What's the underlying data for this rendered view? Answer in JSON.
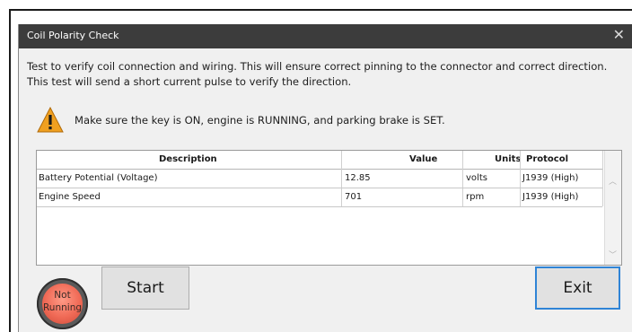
{
  "window": {
    "title": "Coil Polarity Check",
    "close_symbol": "✕"
  },
  "description": {
    "line1": "Test to verify coil connection and wiring. This will ensure correct pinning to the connector and correct direction.",
    "line2": "This test will send a short current pulse to verify the direction."
  },
  "warning": {
    "icon": "warning-triangle-icon",
    "text": "Make sure the key is ON, engine is RUNNING, and parking brake is SET."
  },
  "table": {
    "columns": [
      "Description",
      "Value",
      "Units",
      "Protocol"
    ],
    "rows": [
      [
        "Battery Potential (Voltage)",
        "12.85",
        "volts",
        "J1939 (High)"
      ],
      [
        "Engine Speed",
        "701",
        "rpm",
        "J1939 (High)"
      ]
    ]
  },
  "status": {
    "line1": "Not",
    "line2": "Running",
    "color": "#f06a56"
  },
  "buttons": {
    "start": "Start",
    "exit": "Exit"
  },
  "colors": {
    "titlebar": "#3c3c3c",
    "exit_focus_border": "#2f84d6"
  }
}
